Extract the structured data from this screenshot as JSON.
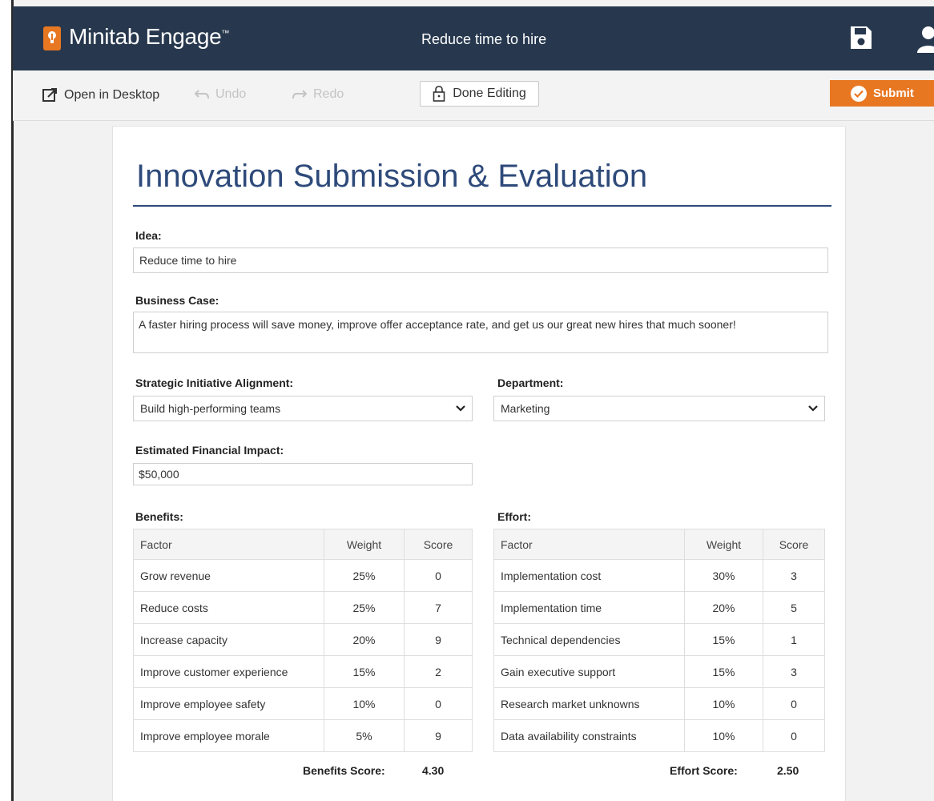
{
  "app": {
    "name": "Minitab Engage",
    "trademark": "™",
    "document_title": "Reduce time to hire"
  },
  "toolbar": {
    "open_desktop": "Open in Desktop",
    "undo": "Undo",
    "redo": "Redo",
    "done_editing": "Done Editing",
    "submit": "Submit"
  },
  "colors": {
    "header_bg": "#27384e",
    "accent": "#e87722",
    "title_blue": "#2e4a7a"
  },
  "form": {
    "title": "Innovation Submission & Evaluation",
    "idea": {
      "label": "Idea:",
      "value": "Reduce time to hire"
    },
    "business_case": {
      "label": "Business Case:",
      "value": "A faster hiring process will save money, improve offer acceptance rate, and get us our great new hires that much sooner!"
    },
    "strategic": {
      "label": "Strategic Initiative Alignment:",
      "value": "Build high-performing teams"
    },
    "department": {
      "label": "Department:",
      "value": "Marketing"
    },
    "financial": {
      "label": "Estimated Financial Impact:",
      "value": "$50,000"
    }
  },
  "benefits": {
    "label": "Benefits:",
    "columns": [
      "Factor",
      "Weight",
      "Score"
    ],
    "rows": [
      [
        "Grow revenue",
        "25%",
        "0"
      ],
      [
        "Reduce costs",
        "25%",
        "7"
      ],
      [
        "Increase capacity",
        "20%",
        "9"
      ],
      [
        "Improve customer experience",
        "15%",
        "2"
      ],
      [
        "Improve employee safety",
        "10%",
        "0"
      ],
      [
        "Improve employee morale",
        "5%",
        "9"
      ]
    ],
    "score_label": "Benefits Score:",
    "score": "4.30"
  },
  "effort": {
    "label": "Effort:",
    "columns": [
      "Factor",
      "Weight",
      "Score"
    ],
    "rows": [
      [
        "Implementation cost",
        "30%",
        "3"
      ],
      [
        "Implementation time",
        "20%",
        "5"
      ],
      [
        "Technical dependencies",
        "15%",
        "1"
      ],
      [
        "Gain executive support",
        "15%",
        "3"
      ],
      [
        "Research market unknowns",
        "10%",
        "0"
      ],
      [
        "Data availability constraints",
        "10%",
        "0"
      ]
    ],
    "score_label": "Effort Score:",
    "score": "2.50"
  }
}
